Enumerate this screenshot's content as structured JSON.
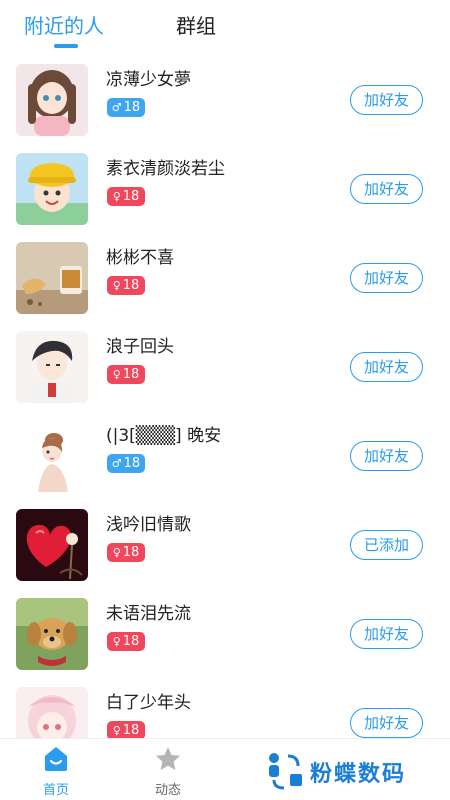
{
  "tabs": [
    {
      "label": "附近的人",
      "active": true
    },
    {
      "label": "群组",
      "active": false
    }
  ],
  "colors": {
    "accent": "#2a9cf0",
    "male": "#3ea6ef",
    "female": "#f0475c"
  },
  "users": [
    {
      "name": "凉薄少女夢",
      "gender": "male",
      "gender_symbol": "♂",
      "age": "18",
      "action": "加好友",
      "avatar": "anime-girl-avatar"
    },
    {
      "name": "素衣清颜淡若尘",
      "gender": "female",
      "gender_symbol": "♀",
      "age": "18",
      "action": "加好友",
      "avatar": "yellow-hat-child-avatar"
    },
    {
      "name": "彬彬不喜",
      "gender": "female",
      "gender_symbol": "♀",
      "age": "18",
      "action": "加好友",
      "avatar": "ginger-tea-photo-avatar"
    },
    {
      "name": "浪子回头",
      "gender": "female",
      "gender_symbol": "♀",
      "age": "18",
      "action": "加好友",
      "avatar": "anime-boy-avatar"
    },
    {
      "name": "(|3[▒▒▒] 晚安",
      "gender": "male",
      "gender_symbol": "♂",
      "age": "18",
      "action": "加好友",
      "avatar": "illustrated-girl-avatar"
    },
    {
      "name": "浅吟旧情歌",
      "gender": "female",
      "gender_symbol": "♀",
      "age": "18",
      "action": "已添加",
      "avatar": "red-heart-avatar"
    },
    {
      "name": "未语泪先流",
      "gender": "female",
      "gender_symbol": "♀",
      "age": "18",
      "action": "加好友",
      "avatar": "golden-retriever-avatar"
    },
    {
      "name": "白了少年头",
      "gender": "female",
      "gender_symbol": "♀",
      "age": "18",
      "action": "加好友",
      "avatar": "pink-anime-avatar"
    }
  ],
  "nav": {
    "home_label": "首页",
    "dynamic_label": "动态"
  },
  "watermark": {
    "text": "粉蝶数码"
  }
}
